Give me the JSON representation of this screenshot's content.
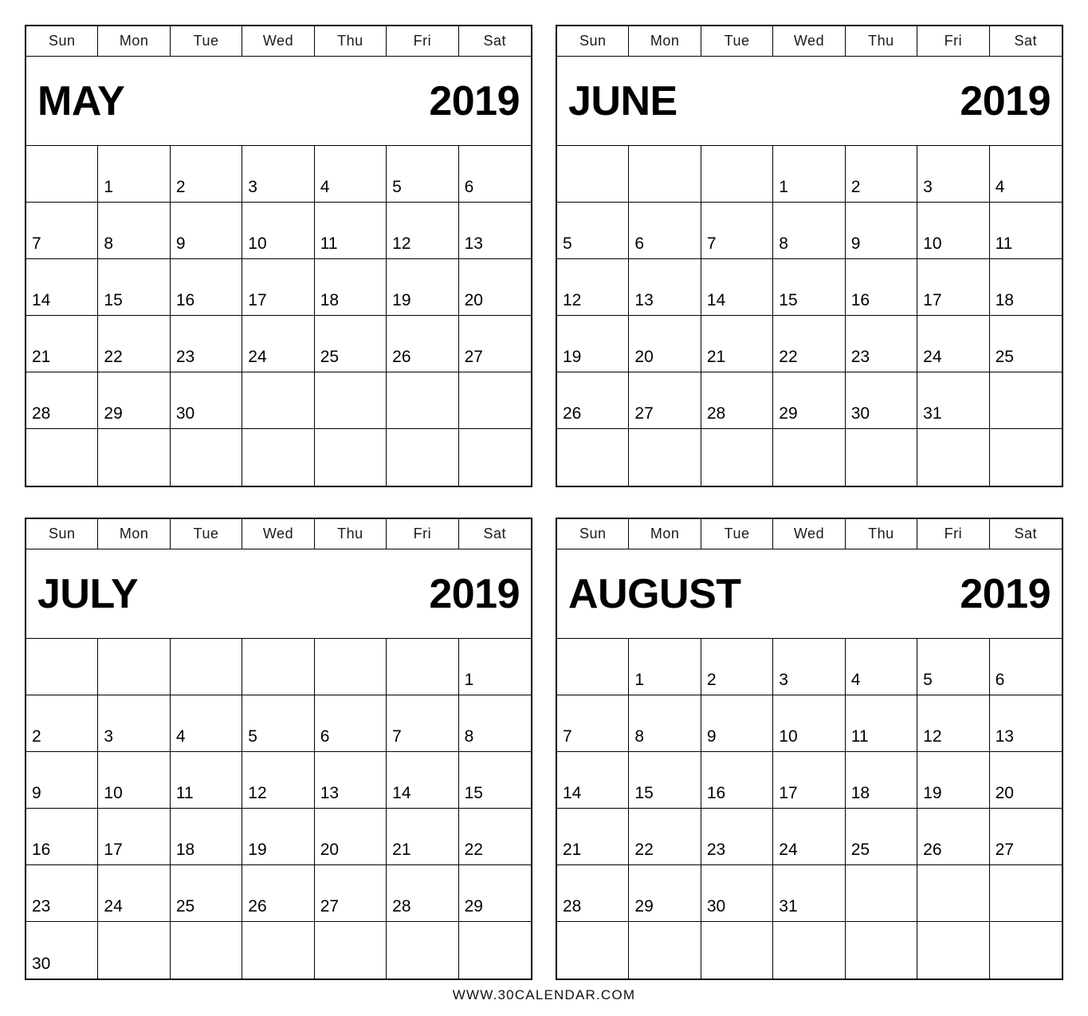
{
  "weekdays": [
    "Sun",
    "Mon",
    "Tue",
    "Wed",
    "Thu",
    "Fri",
    "Sat"
  ],
  "footer": {
    "text": "WWW.30CALENDAR.COM"
  },
  "months": [
    {
      "name": "MAY",
      "year": "2019",
      "weeks": [
        [
          "",
          "1",
          "2",
          "3",
          "4",
          "5",
          "6"
        ],
        [
          "7",
          "8",
          "9",
          "10",
          "11",
          "12",
          "13"
        ],
        [
          "14",
          "15",
          "16",
          "17",
          "18",
          "19",
          "20"
        ],
        [
          "21",
          "22",
          "23",
          "24",
          "25",
          "26",
          "27"
        ],
        [
          "28",
          "29",
          "30",
          "",
          "",
          "",
          ""
        ],
        [
          "",
          "",
          "",
          "",
          "",
          "",
          ""
        ]
      ]
    },
    {
      "name": "JUNE",
      "year": "2019",
      "weeks": [
        [
          "",
          "",
          "",
          "1",
          "2",
          "3",
          "4"
        ],
        [
          "5",
          "6",
          "7",
          "8",
          "9",
          "10",
          "11"
        ],
        [
          "12",
          "13",
          "14",
          "15",
          "16",
          "17",
          "18"
        ],
        [
          "19",
          "20",
          "21",
          "22",
          "23",
          "24",
          "25"
        ],
        [
          "26",
          "27",
          "28",
          "29",
          "30",
          "31",
          ""
        ],
        [
          "",
          "",
          "",
          "",
          "",
          "",
          ""
        ]
      ]
    },
    {
      "name": "JULY",
      "year": "2019",
      "weeks": [
        [
          "",
          "",
          "",
          "",
          "",
          "",
          "1"
        ],
        [
          "2",
          "3",
          "4",
          "5",
          "6",
          "7",
          "8"
        ],
        [
          "9",
          "10",
          "11",
          "12",
          "13",
          "14",
          "15"
        ],
        [
          "16",
          "17",
          "18",
          "19",
          "20",
          "21",
          "22"
        ],
        [
          "23",
          "24",
          "25",
          "26",
          "27",
          "28",
          "29"
        ],
        [
          "30",
          "",
          "",
          "",
          "",
          "",
          ""
        ]
      ]
    },
    {
      "name": "AUGUST",
      "year": "2019",
      "weeks": [
        [
          "",
          "1",
          "2",
          "3",
          "4",
          "5",
          "6"
        ],
        [
          "7",
          "8",
          "9",
          "10",
          "11",
          "12",
          "13"
        ],
        [
          "14",
          "15",
          "16",
          "17",
          "18",
          "19",
          "20"
        ],
        [
          "21",
          "22",
          "23",
          "24",
          "25",
          "26",
          "27"
        ],
        [
          "28",
          "29",
          "30",
          "31",
          "",
          "",
          ""
        ],
        [
          "",
          "",
          "",
          "",
          "",
          "",
          ""
        ]
      ]
    }
  ]
}
